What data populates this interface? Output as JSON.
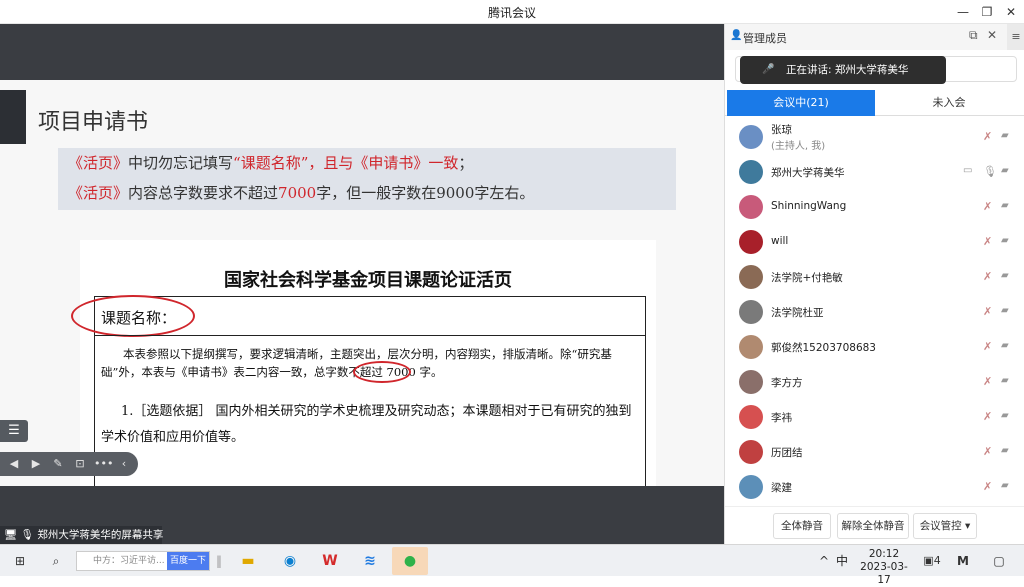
{
  "window": {
    "title": "腾讯会议"
  },
  "share": {
    "slide_title": "项目申请书",
    "note_line1": [
      "《活页》",
      "中切勿忘记填写",
      "“课题名称”，且与《申请书》一致",
      "；"
    ],
    "note_line2": [
      "《活页》",
      "内容总字数要求不超过",
      "7000",
      "字，但一般字数在9000字左右。"
    ],
    "doc_title": "国家社会科学基金项目课题论证活页",
    "field_name": "课题名称：",
    "doc_para": "本表参照以下提纲撰写，要求逻辑清晰，主题突出，层次分明，内容翔实，排版清晰。除“研究基础”外，本表与《申请书》表二内容一致，总字数不超过 7000 字。",
    "doc_item": "1.［选题依据］ 国内外相关研究的学术史梳理及研究动态；本课题相对于已有研究的独到学术价值和应用价值等。",
    "share_label": "郑州大学蒋美华的屏幕共享"
  },
  "panel": {
    "title": "管理成员",
    "speaking": "正在讲话: 郑州大学蒋美华",
    "tabs": [
      {
        "label": "会议中(21)"
      },
      {
        "label": "未入会"
      }
    ],
    "members": [
      {
        "name": "张琼",
        "sub": "(主持人, 我)",
        "avatar_color": "#6a8fc4"
      },
      {
        "name": "郑州大学蒋美华",
        "sub": "",
        "avatar_color": "#3f7a9c"
      },
      {
        "name": "ShinningWang",
        "sub": "",
        "avatar_color": "#c85a7a"
      },
      {
        "name": "will",
        "sub": "",
        "avatar_color": "#a8202a"
      },
      {
        "name": "法学院+付艳敏",
        "sub": "",
        "avatar_color": "#8a6a55"
      },
      {
        "name": "法学院杜亚",
        "sub": "",
        "avatar_color": "#7a7a7a"
      },
      {
        "name": "郭俊然15203708683",
        "sub": "",
        "avatar_color": "#b08a70"
      },
      {
        "name": "李方方",
        "sub": "",
        "avatar_color": "#8a6f6a"
      },
      {
        "name": "李祎",
        "sub": "",
        "avatar_color": "#d65050"
      },
      {
        "name": "历团结",
        "sub": "",
        "avatar_color": "#c04040"
      },
      {
        "name": "梁建",
        "sub": "",
        "avatar_color": "#5c8fb8"
      }
    ],
    "footer": {
      "mute_all": "全体静音",
      "unmute_all": "解除全体静音",
      "control": "会议管控"
    }
  },
  "taskbar": {
    "search_placeholder": "中方：习近平访...",
    "search_button": "百度一下",
    "ime": "中",
    "time": "20:12",
    "date": "2023-03-17",
    "notif_count": "4"
  }
}
